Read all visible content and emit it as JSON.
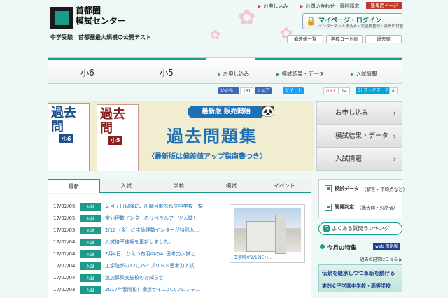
{
  "header": {
    "logo_text": "首都圏\n模試センター",
    "tagline": "中学受験　首都圏最大規模の公開テスト",
    "top_links": [
      "お申し込み",
      "お問い合わせ・資料請求"
    ],
    "staff_link": "塾専用ページ",
    "mypage": {
      "title": "マイページ・ログイン",
      "sub": "インターネット申込み・志望校登録・会員ID付替"
    },
    "sub_buttons": [
      "偏差値一覧",
      "学校コード表",
      "過去問"
    ]
  },
  "nav": {
    "grades": [
      "小6",
      "小5"
    ],
    "links": [
      "お申し込み",
      "模試結果・データ",
      "入試情報"
    ]
  },
  "social": {
    "like_label": "いいね！",
    "like_count": "161",
    "share_label": "シェア",
    "tweet_label": "ツイート",
    "gplus_label": "G+1",
    "gplus_count": "14",
    "hatena_label": "B! ブックマーク",
    "hatena_count": "8"
  },
  "banner": {
    "book1_big": "過去\n問",
    "book1_label": "小6",
    "book2_big": "過去\n問",
    "book2_label": "小5",
    "pill": "最新版 販売開始",
    "title": "過去問題集",
    "sub": "〈最新版は偏差値アップ指南書つき〉"
  },
  "side_buttons": [
    "お申し込み",
    "模試結果・データ",
    "入試情報"
  ],
  "news": {
    "tabs": [
      "最新",
      "入試",
      "学校",
      "模試",
      "イベント"
    ],
    "items": [
      {
        "date": "17/02/06",
        "badge": "入試",
        "title": "２月７日以降に、出願可能な私立中学校一覧"
      },
      {
        "date": "17/02/05",
        "badge": "入試",
        "title": "宝仙理数インターのリベラルアーツ入試！"
      },
      {
        "date": "17/02/05",
        "badge": "入試",
        "title": "2/10（金）に宝仙理数インターが特別入..."
      },
      {
        "date": "17/02/04",
        "badge": "入試",
        "title": "入試倍率速報を更新しました。"
      },
      {
        "date": "17/02/04",
        "badge": "入試",
        "title": "2月4日、かえつ有明中のAL思考力入試と..."
      },
      {
        "date": "17/02/04",
        "badge": "入試",
        "title": "工学院が2/12にハイブリッド思考力入試..."
      },
      {
        "date": "17/02/04",
        "badge": "入試",
        "title": "追加募集実施校のお知らせ"
      },
      {
        "date": "17/02/03",
        "badge": "入試",
        "title": "2017年春開校！横浜サイエンスフロンテ..."
      }
    ],
    "photo_caption": "工学院が2/12にハ..."
  },
  "right": {
    "links": [
      {
        "title": "模試データ",
        "detail": "（解答・平均点など）"
      },
      {
        "title": "簡易判定",
        "detail": "（過去問・欠席者）"
      }
    ],
    "faq": "よくある質問ランキング",
    "feature_title": "今月の特集",
    "feature_badge": "web 限定版",
    "past_link": "過去の記事はこちら ▶",
    "ad_line1": "伝統を継承しつつ革新を続ける",
    "ad_line2": "実践女子学園中学校・高等学校"
  }
}
